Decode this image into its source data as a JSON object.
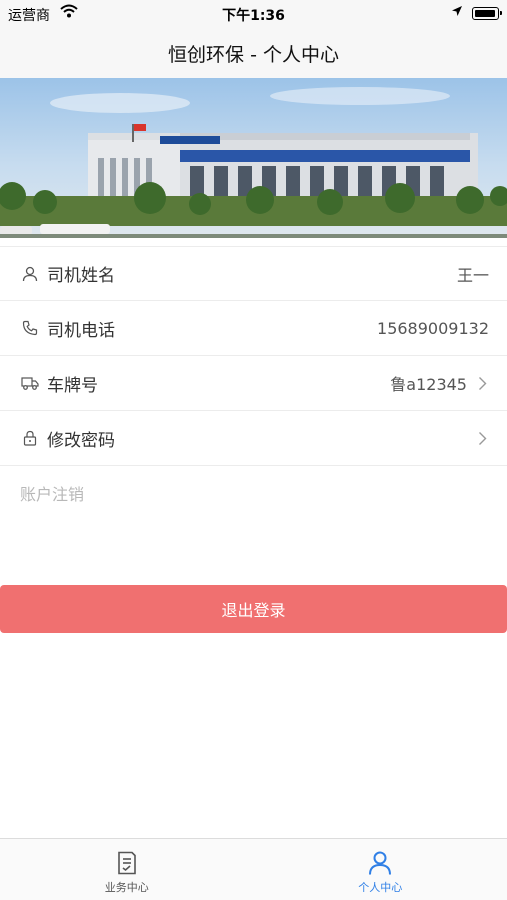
{
  "status_bar": {
    "carrier": "运营商",
    "time": "下午1:36"
  },
  "header": {
    "title": "恒创环保 - 个人中心"
  },
  "profile": {
    "rows": [
      {
        "label": "司机姓名",
        "value": "王一",
        "icon": "person-icon"
      },
      {
        "label": "司机电话",
        "value": "15689009132",
        "icon": "phone-icon"
      },
      {
        "label": "车牌号",
        "value": "鲁a12345",
        "icon": "truck-icon"
      },
      {
        "label": "修改密码",
        "value": "",
        "icon": "lock-icon"
      }
    ]
  },
  "account_cancel": "账户注销",
  "logout_label": "退出登录",
  "tabs": [
    {
      "label": "业务中心",
      "icon": "document-icon",
      "active": false
    },
    {
      "label": "个人中心",
      "icon": "person-icon",
      "active": true
    }
  ],
  "colors": {
    "accent": "#2f7fe6",
    "logout": "#f07070"
  }
}
